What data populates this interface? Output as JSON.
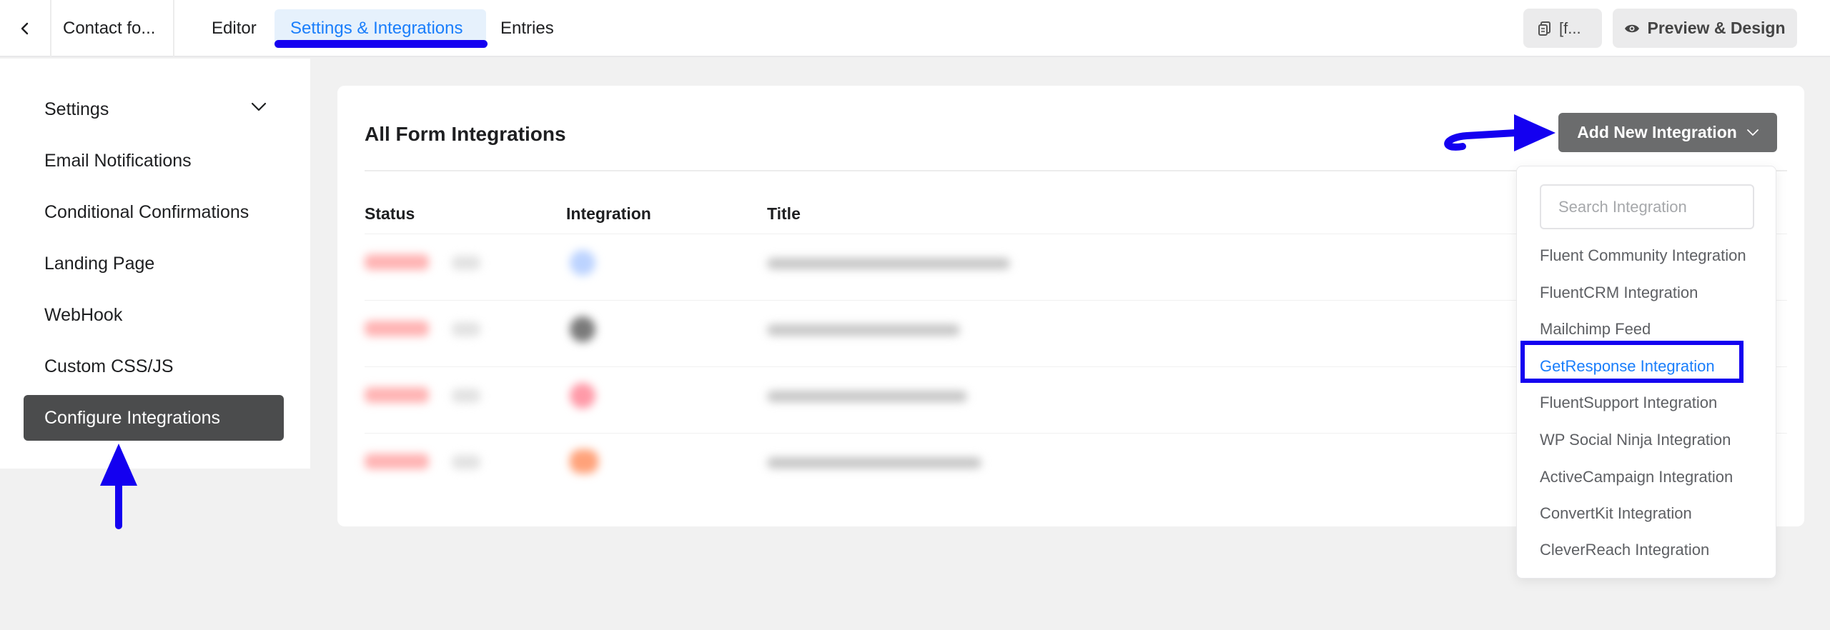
{
  "header": {
    "back_icon": "chevron-left-icon",
    "form_name": "Contact fo...",
    "tabs": [
      {
        "label": "Editor",
        "active": false
      },
      {
        "label": "Settings & Integrations",
        "active": true
      },
      {
        "label": "Entries",
        "active": false
      }
    ],
    "shortcode_label": "[f...",
    "shortcode_icon": "copy-icon",
    "preview_label": "Preview & Design",
    "preview_icon": "eye-icon"
  },
  "sidebar": {
    "items": [
      {
        "label": "Settings",
        "expandable": true
      },
      {
        "label": "Email Notifications"
      },
      {
        "label": "Conditional Confirmations"
      },
      {
        "label": "Landing Page"
      },
      {
        "label": "WebHook"
      },
      {
        "label": "Custom CSS/JS"
      },
      {
        "label": "Configure Integrations",
        "active": true
      }
    ]
  },
  "main": {
    "title": "All Form Integrations",
    "add_button_label": "Add New Integration",
    "columns": [
      "Status",
      "Integration",
      "Title"
    ],
    "rows_blurred": true
  },
  "dropdown": {
    "search_placeholder": "Search Integration",
    "items": [
      "Fluent Community Integration",
      "FluentCRM Integration",
      "Mailchimp Feed",
      "GetResponse Integration",
      "FluentSupport Integration",
      "WP Social Ninja Integration",
      "ActiveCampaign Integration",
      "ConvertKit Integration",
      "CleverReach Integration"
    ],
    "highlighted_index": 3
  },
  "colors": {
    "accent": "#1a7efb",
    "annotation": "#1400f0",
    "active_sidebar": "#4b4c4d",
    "add_button": "#6b6c6d"
  }
}
